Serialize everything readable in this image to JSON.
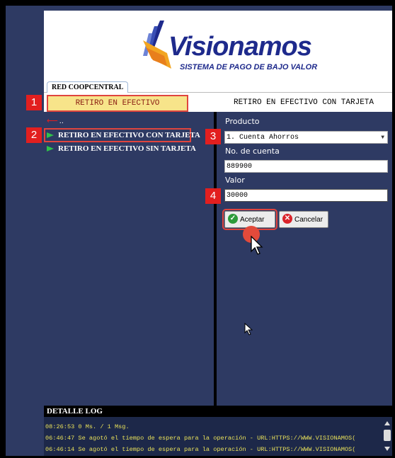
{
  "header": {
    "logo_text": "Visionamos",
    "logo_subtitle": "SISTEMA DE PAGO DE BAJO VALOR"
  },
  "tabs": [
    {
      "label": "RED COOPCENTRAL"
    }
  ],
  "title_bar": {
    "left": "RETIRO EN EFECTIVO",
    "right": "RETIRO EN EFECTIVO CON TARJETA"
  },
  "menu": {
    "back_dots": "..",
    "items": [
      {
        "label": "RETIRO EN EFECTIVO CON TARJETA"
      },
      {
        "label": "RETIRO EN EFECTIVO SIN TARJETA"
      }
    ]
  },
  "form": {
    "producto_label": "Producto",
    "producto_value": "1. Cuenta Ahorros",
    "cuenta_label": "No. de cuenta",
    "cuenta_value": "889900",
    "valor_label": "Valor",
    "valor_value": "30000",
    "accept_label": "Aceptar",
    "cancel_label": "Cancelar"
  },
  "badges": [
    "1",
    "2",
    "3",
    "4"
  ],
  "log": {
    "title": "DETALLE LOG",
    "lines": [
      "08:26:53 0 Ms. / 1 Msg.",
      "06:46:47 Se agotó el tiempo de espera para la operación - URL:HTTPS://WWW.VISIONAMOS(",
      "06:46:14 Se agotó el tiempo de espera para la operación - URL:HTTPS://WWW.VISIONAMOS("
    ]
  },
  "colors": {
    "panel_bg": "#2e3a63",
    "highlight_border": "#e0453e",
    "title_bg": "#f7e48a",
    "log_text": "#e8e05a",
    "brand_blue": "#1e2a8c"
  }
}
